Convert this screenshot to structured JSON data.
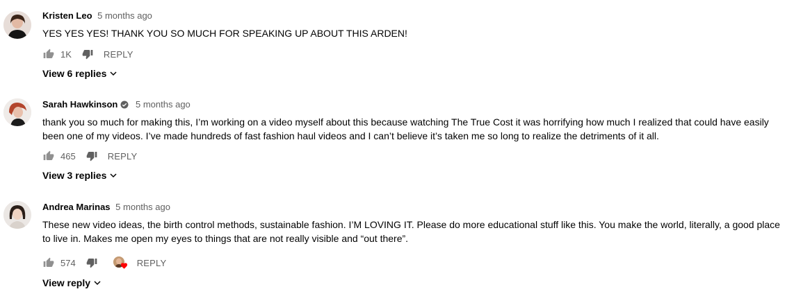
{
  "comments": [
    {
      "author": "Kristen Leo",
      "verified": false,
      "time": "5 months ago",
      "text": "YES YES YES! THANK YOU SO MUCH FOR SPEAKING UP ABOUT THIS ARDEN!",
      "likes": "1K",
      "reply_label": "REPLY",
      "view_replies_label": "View 6 replies"
    },
    {
      "author": "Sarah Hawkinson",
      "verified": true,
      "time": "5 months ago",
      "text": "thank you so much for making this, I’m working on a video myself about this because watching The True Cost it was horrifying how much I realized that could have easily been one of my videos. I’ve made hundreds of fast fashion haul videos and I can’t believe it’s taken me so long to realize the detriments of it all.",
      "likes": "465",
      "reply_label": "REPLY",
      "view_replies_label": "View 3 replies"
    },
    {
      "author": "Andrea Marinas",
      "verified": false,
      "time": "5 months ago",
      "text": "These new video ideas, the birth control methods, sustainable fashion. I’M LOVING IT. Please do more educational stuff like this. You make the world, literally, a good place to live in. Makes me open my eyes to things that are not really visible and “out there”.",
      "likes": "574",
      "hearted": true,
      "reply_label": "REPLY",
      "view_replies_label": "View reply"
    }
  ],
  "colors": {
    "text_primary": "#030303",
    "text_secondary": "#606060",
    "heart": "#ff0000"
  },
  "icons": [
    "thumbs-up-icon",
    "thumbs-down-icon",
    "verified-check-icon",
    "chevron-down-icon",
    "heart-icon"
  ]
}
